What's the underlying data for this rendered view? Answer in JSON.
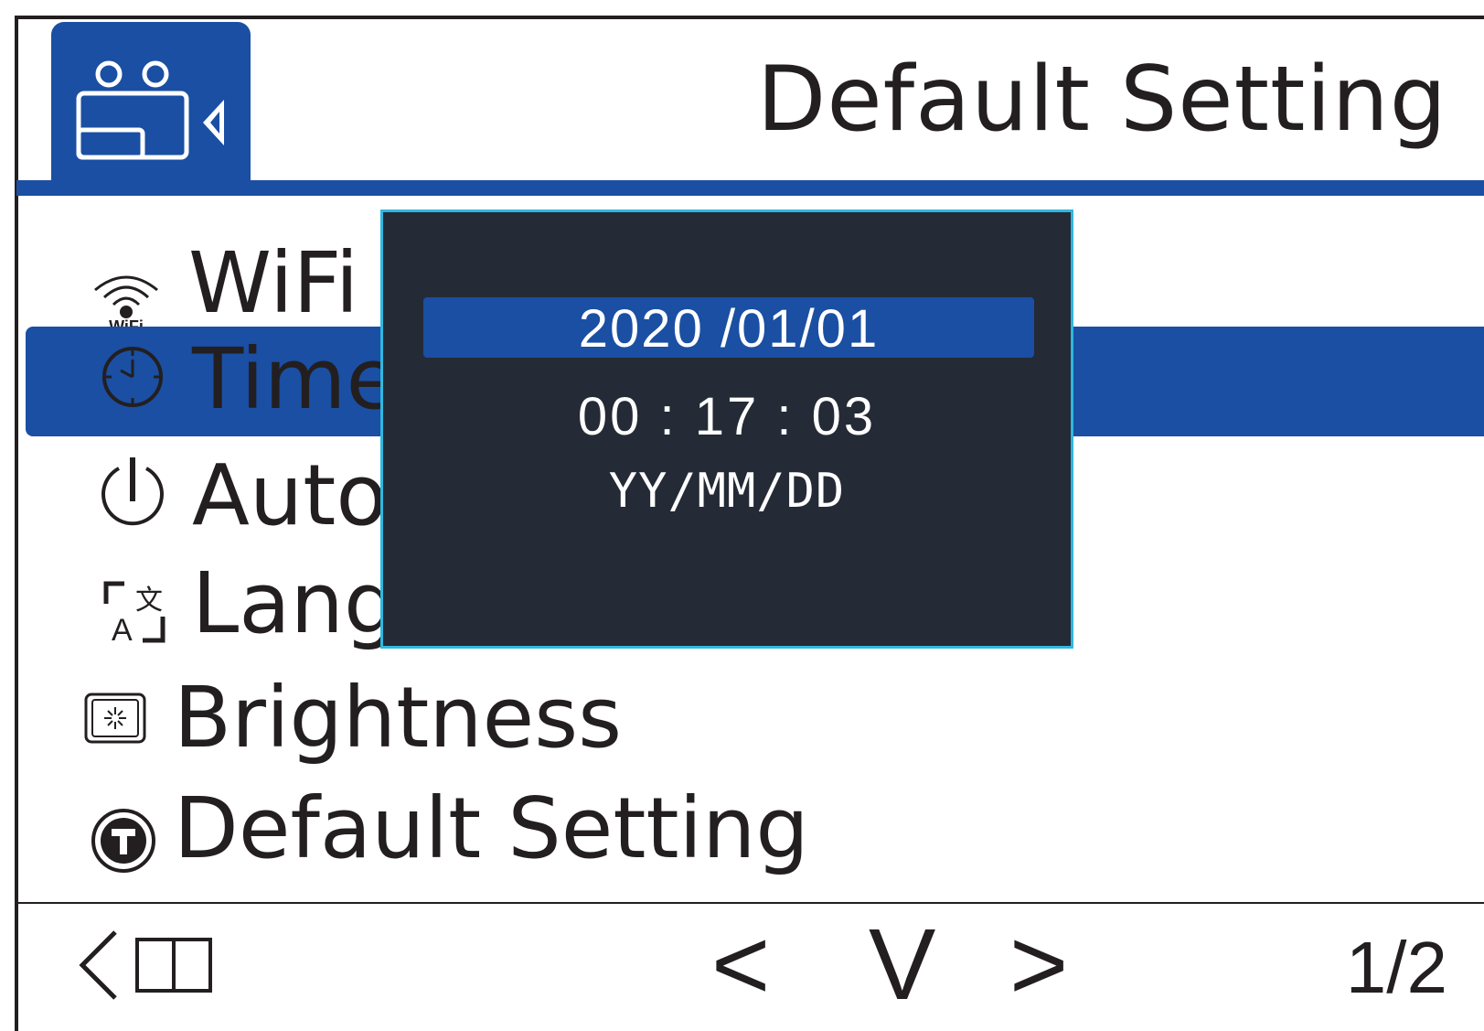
{
  "header": {
    "title": "Default Setting",
    "mode_icon": "camera-setup-icon"
  },
  "menu": {
    "items": [
      {
        "label": "WiFi",
        "icon": "wifi-icon",
        "icon_caption": "WiFi"
      },
      {
        "label": "Time",
        "icon": "clock-icon",
        "selected": true
      },
      {
        "label": "Auto",
        "icon": "power-icon"
      },
      {
        "label": "Lang",
        "icon": "language-icon"
      },
      {
        "label": "Brightness",
        "icon": "brightness-icon"
      },
      {
        "label": "Default Setting",
        "icon": "reset-icon"
      }
    ]
  },
  "popup": {
    "date": "2020 /01/01",
    "time": "00 : 17 : 03",
    "format": "YY/MM/DD"
  },
  "footer": {
    "prev_label": "<",
    "confirm_label": "V",
    "next_label": ">",
    "page": "1/2",
    "back_icon": "back-icon"
  },
  "colors": {
    "accent": "#1a4fa3",
    "popup_bg": "#242a36",
    "popup_border": "#2fb8e0"
  }
}
